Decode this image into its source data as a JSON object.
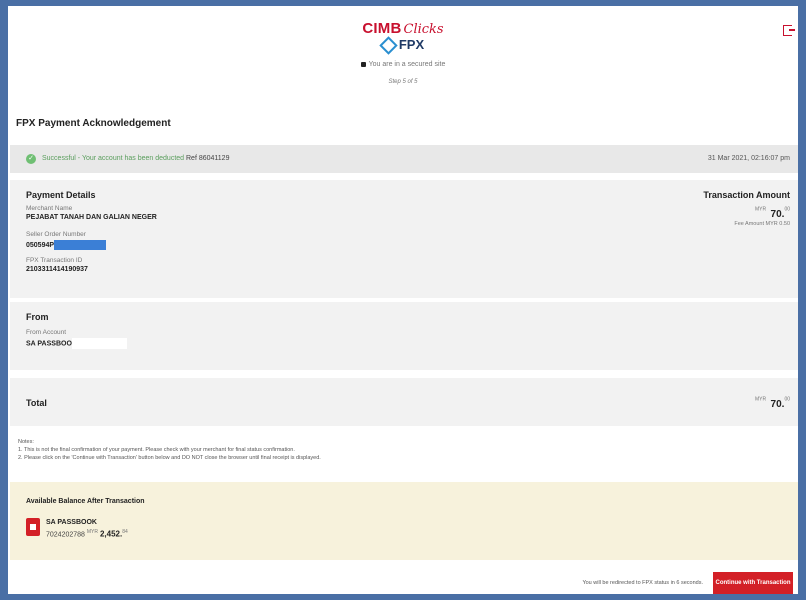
{
  "header": {
    "brand_cimb": "CIMB",
    "brand_clicks": "Clicks",
    "brand_fpx": "FPX",
    "secure_text": "You are in a secured site",
    "step_text": "Step 5 of 5"
  },
  "page_title": "FPX Payment Acknowledgement",
  "status": {
    "message": "Successful - Your account has been deducted",
    "ref": "Ref 86041129",
    "datetime": "31 Mar 2021, 02:16:07 pm"
  },
  "payment_details": {
    "heading": "Payment Details",
    "merchant_label": "Merchant Name",
    "merchant_value": "PEJABAT TANAH DAN GALIAN NEGER",
    "seller_label": "Seller Order Number",
    "seller_value": "050594P",
    "fpx_label": "FPX Transaction ID",
    "fpx_value": "2103311414190937"
  },
  "transaction_amount": {
    "heading": "Transaction Amount",
    "currency": "MYR",
    "amount_main": "70.",
    "amount_cents": "00",
    "fee_text": "Fee Amount MYR 0.50"
  },
  "from": {
    "heading": "From",
    "account_label": "From Account",
    "account_value": "SA PASSBOO"
  },
  "total": {
    "label": "Total",
    "currency": "MYR",
    "amount_main": "70.",
    "amount_cents": "00"
  },
  "notes": {
    "heading": "Notes:",
    "line1": "1. This is not the final confirmation of your payment. Please check with your merchant for final status confirmation.",
    "line2": "2. Please click on the 'Continue with Transaction' button below and DO NOT close the browser until final receipt is displayed."
  },
  "balance": {
    "heading": "Available Balance After Transaction",
    "account_name": "SA PASSBOOK",
    "account_number": "7024202788",
    "currency": "MYR",
    "amount_main": "2,452.",
    "amount_cents": "84"
  },
  "footer": {
    "redirect_text": "You will be redirected to FPX status in 6 seconds.",
    "continue_label": "Continue with Transaction"
  },
  "colors": {
    "accent": "#d32027",
    "success": "#6fbf73",
    "balance_bg": "#f7f2dc"
  }
}
